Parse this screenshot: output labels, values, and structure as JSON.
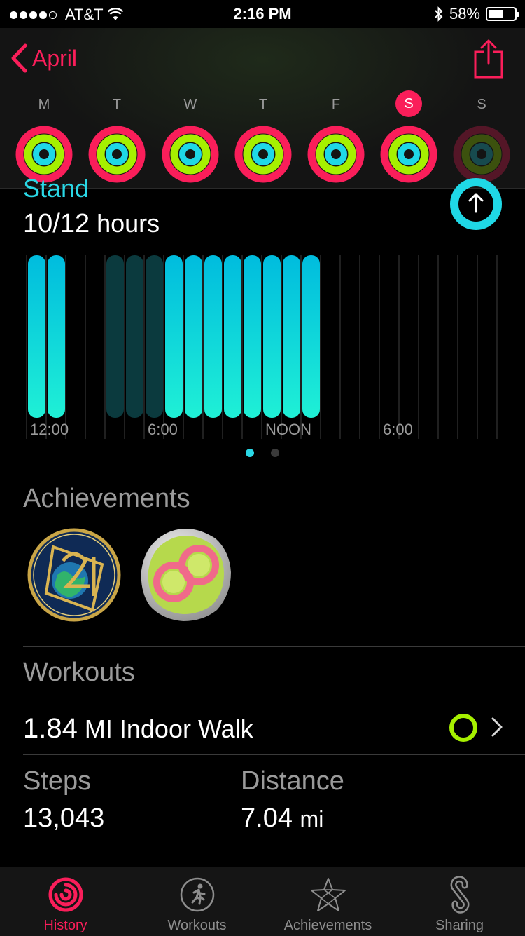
{
  "status_bar": {
    "carrier": "AT&T",
    "time": "2:16 PM",
    "battery": "58%",
    "battery_level": 0.58,
    "signal_bars": 4
  },
  "header": {
    "back_label": "April",
    "weekdays": [
      {
        "label": "M",
        "selected": false,
        "dim": false
      },
      {
        "label": "T",
        "selected": false,
        "dim": false
      },
      {
        "label": "W",
        "selected": false,
        "dim": false
      },
      {
        "label": "T",
        "selected": false,
        "dim": false
      },
      {
        "label": "F",
        "selected": false,
        "dim": false
      },
      {
        "label": "S",
        "selected": true,
        "dim": false
      },
      {
        "label": "S",
        "selected": false,
        "dim": true
      }
    ]
  },
  "stand": {
    "title": "Stand",
    "value": "10/12",
    "unit": "hours"
  },
  "chart_data": {
    "type": "bar",
    "x_tick_labels": [
      "12:00",
      "6:00",
      "NOON",
      "6:00"
    ],
    "hours": [
      0,
      1,
      2,
      3,
      4,
      5,
      6,
      7,
      8,
      9,
      10,
      11,
      12,
      13,
      14,
      15,
      16,
      17,
      18,
      19,
      20,
      21,
      22,
      23
    ],
    "stood": [
      1,
      1,
      0,
      0,
      2,
      2,
      2,
      1,
      1,
      1,
      1,
      1,
      1,
      1,
      1,
      0,
      0,
      0,
      0,
      0,
      0,
      0,
      0,
      0
    ],
    "legend_note": "",
    "colors": {
      "stood": "#1fe3e0",
      "partial": "#0b3a3e",
      "grid": "#2a2a2a"
    }
  },
  "pager": {
    "count": 2,
    "active": 0
  },
  "achievements": {
    "title": "Achievements",
    "badges": [
      {
        "icon": "earth-day-2017-badge-icon"
      },
      {
        "icon": "perfect-week-badge-icon"
      }
    ]
  },
  "workouts": {
    "title": "Workouts",
    "items": [
      {
        "distance": "1.84",
        "unit": "MI",
        "name": "Indoor Walk"
      }
    ]
  },
  "stats": {
    "steps_label": "Steps",
    "steps_value": "13,043",
    "distance_label": "Distance",
    "distance_value": "7.04",
    "distance_unit": "mi"
  },
  "tabs": [
    {
      "label": "History",
      "icon": "history-rings-icon",
      "active": true
    },
    {
      "label": "Workouts",
      "icon": "workouts-runner-icon",
      "active": false
    },
    {
      "label": "Achievements",
      "icon": "achievements-star-icon",
      "active": false
    },
    {
      "label": "Sharing",
      "icon": "sharing-icon",
      "active": false
    }
  ],
  "colors": {
    "move": "#fa1e5a",
    "exercise": "#a6f000",
    "stand": "#1fd8e6",
    "accent": "#fa1e5a"
  }
}
